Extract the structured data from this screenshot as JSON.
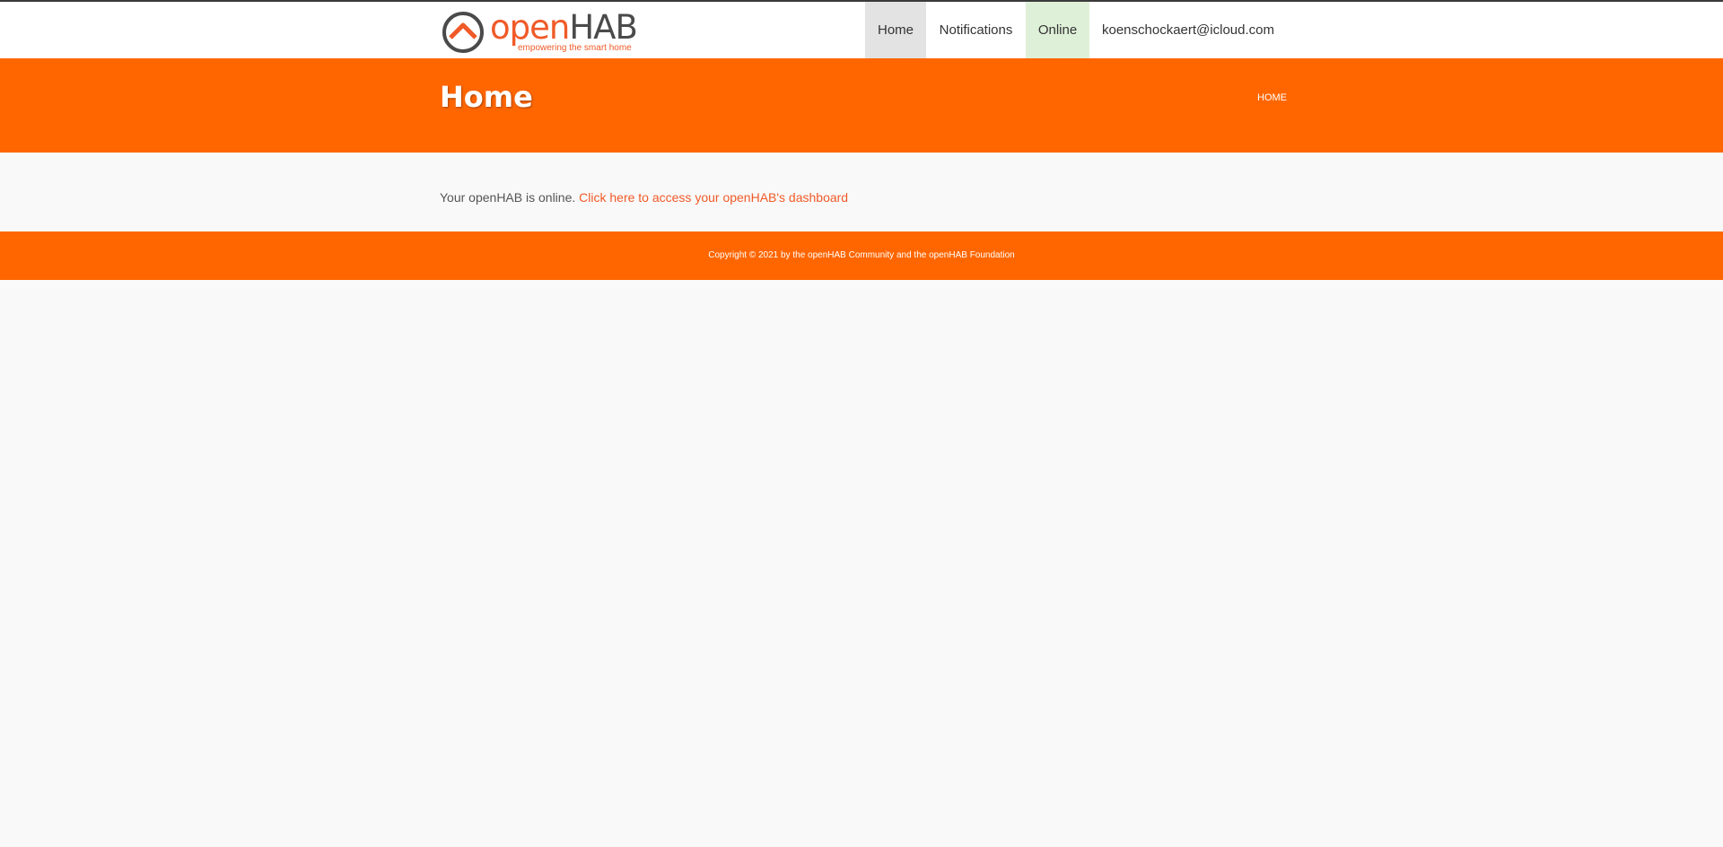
{
  "brand": {
    "word_open": "open",
    "word_hab": "HAB",
    "tagline": "empowering the smart home",
    "colors": {
      "orange": "#ff6600",
      "logo_orange": "#f05a28",
      "logo_gray": "#4a4a4a"
    }
  },
  "nav": {
    "home": "Home",
    "notifications": "Notifications",
    "online": "Online",
    "user": "koenschockaert@icloud.com"
  },
  "banner": {
    "title": "Home",
    "breadcrumb": "HOME"
  },
  "content": {
    "status_text": "Your openHAB is online.",
    "dashboard_link": "Click here to access your openHAB's dashboard"
  },
  "footer": {
    "copyright": "Copyright © 2021 by the openHAB Community and the openHAB Foundation"
  }
}
